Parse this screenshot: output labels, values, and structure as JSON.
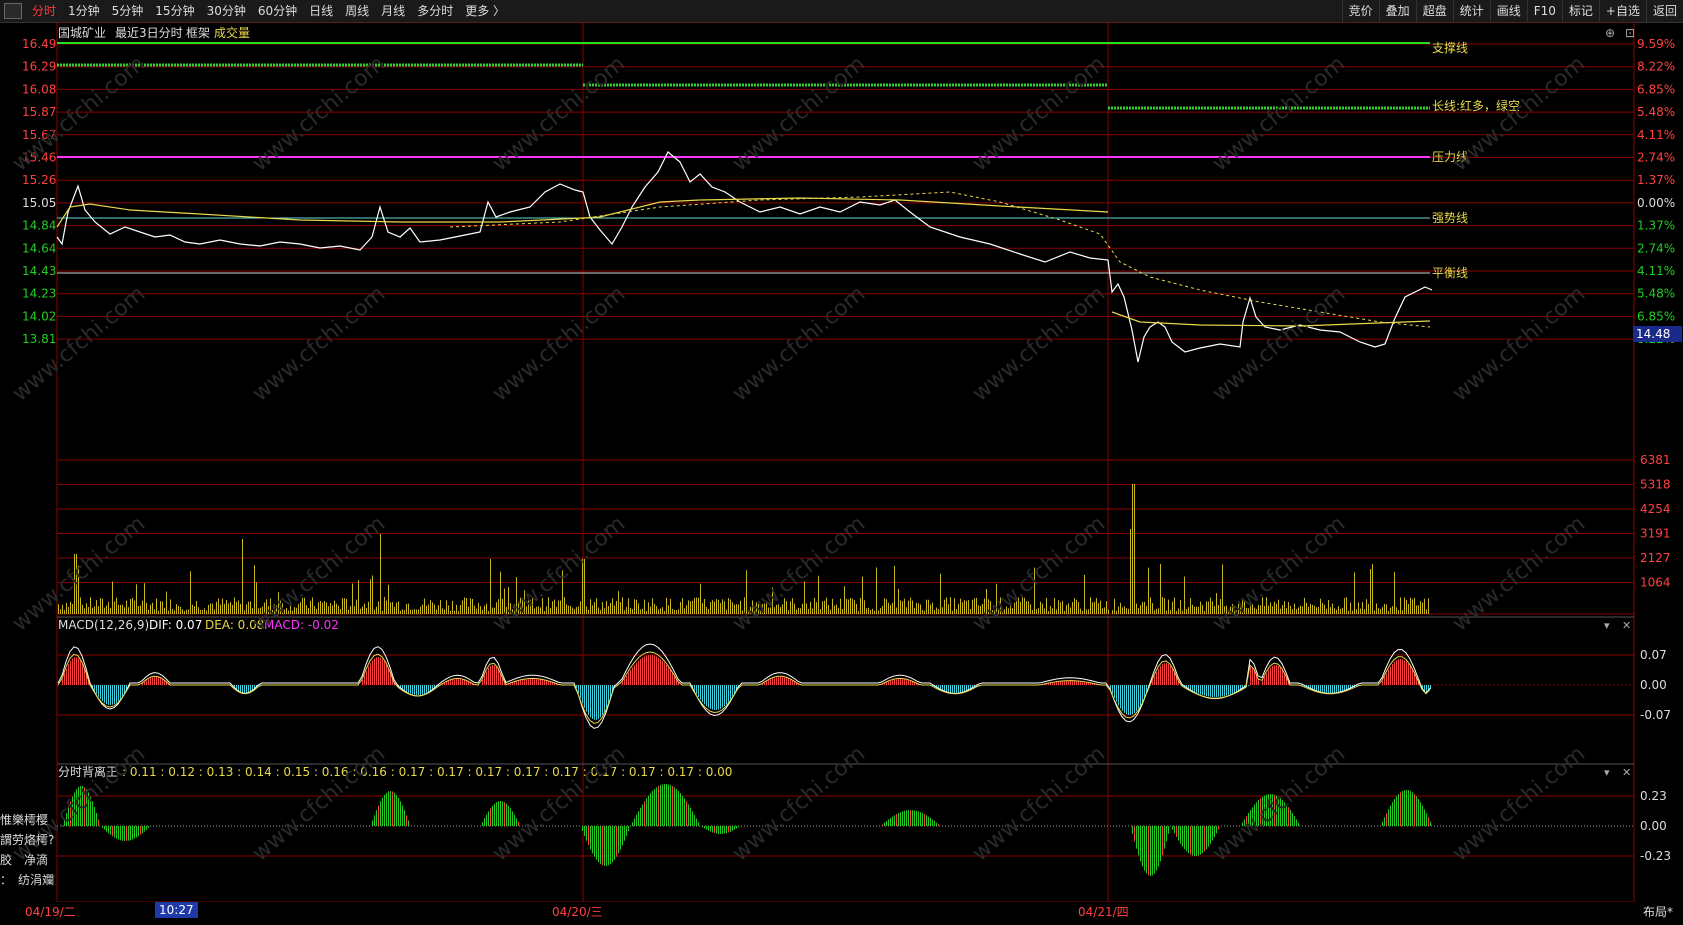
{
  "toolbar": {
    "left_items": [
      "分时",
      "1分钟",
      "5分钟",
      "15分钟",
      "30分钟",
      "60分钟",
      "日线",
      "周线",
      "月线",
      "多分时",
      "更多 〉"
    ],
    "active": "分时",
    "right_items": [
      "竞价",
      "叠加",
      "超盘",
      "统计",
      "画线",
      "F10",
      "标记",
      "+自选",
      "返回"
    ]
  },
  "chart_header": {
    "stock_name": "国城矿业",
    "period": "最近3日分时",
    "frame": "框架",
    "volume": "成交量"
  },
  "price_axis": {
    "left": [
      "16.49",
      "16.29",
      "16.08",
      "15.87",
      "15.67",
      "15.46",
      "15.26",
      "15.05",
      "14.84",
      "14.64",
      "14.43",
      "14.23",
      "14.02",
      "13.81"
    ],
    "right": [
      "9.59%",
      "8.22%",
      "6.85%",
      "5.48%",
      "4.11%",
      "2.74%",
      "1.37%",
      "0.00%",
      "1.37%",
      "2.74%",
      "4.11%",
      "5.48%",
      "6.85%",
      "8.22%"
    ]
  },
  "volume_axis": [
    "6381",
    "5318",
    "4254",
    "3191",
    "2127",
    "1064"
  ],
  "annotations": {
    "support": "支撑线",
    "long_line": "长线:红多，绿空",
    "pressure": "压力线",
    "strong": "强势线",
    "balance": "平衡线"
  },
  "current_price": "14.48",
  "macd": {
    "title": "MACD(12,26,9)",
    "dif": "DIF: 0.07",
    "dea": "DEA: 0.08",
    "macd": "MACD: -0.02",
    "axis": [
      "0.07",
      "0.00",
      "-0.07"
    ]
  },
  "divergence": {
    "title": "分时背离王",
    "values": ": 0.11 : 0.12 : 0.13 : 0.14 : 0.15 : 0.16 : 0.16 : 0.17 : 0.17 : 0.17 : 0.17 : 0.17 : 0.17 : 0.17 : 0.17 : 0.00",
    "axis": [
      "0.23",
      "0.00",
      "-0.23"
    ]
  },
  "left_labels": [
    "惟樂樗樱",
    "謂劳烙樗?",
    "胶　净滴",
    "：　纺涓斕"
  ],
  "dates": [
    "04/19/二",
    "04/20/三",
    "04/21/四"
  ],
  "time_badge": "10:27",
  "layout_button": "布局*",
  "watermark": "www.cfchi.com",
  "colors": {
    "price_line": "#ffffff",
    "avg_line": "#e8d84a",
    "support": "#22dd22",
    "pressure": "#ff33ff",
    "strong": "#66d9d9",
    "grid": "#8a0000",
    "up": "#ff4040",
    "down": "#3fd0e0"
  }
}
